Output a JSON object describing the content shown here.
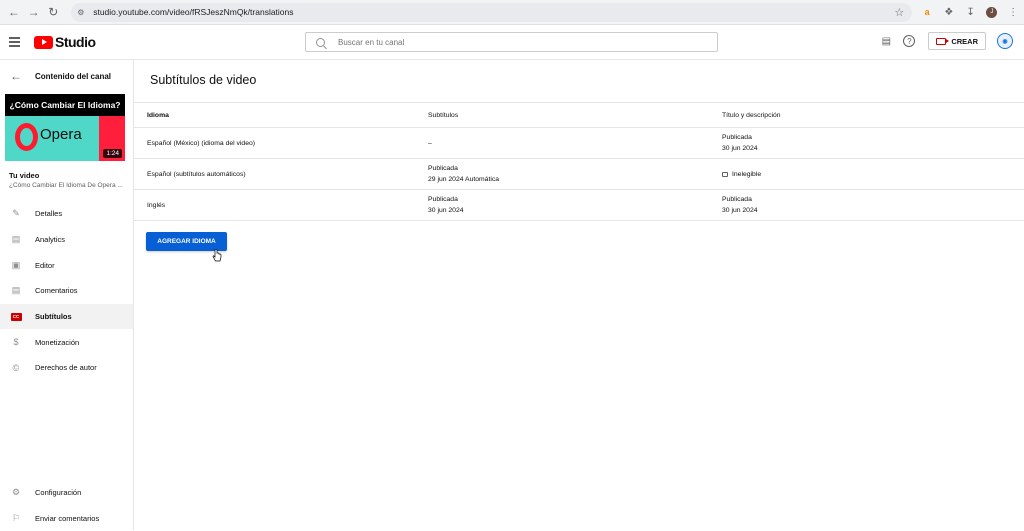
{
  "browser": {
    "url": "studio.youtube.com/video/fRSJeszNmQk/translations",
    "back_icon": "arrow-left",
    "forward_icon": "arrow-right",
    "reload_icon": "reload",
    "profile_initial": "J"
  },
  "header": {
    "logo_text": "Studio",
    "search_placeholder": "Buscar en tu canal",
    "create_label": "CREAR"
  },
  "sidebar": {
    "back_label": "Contenido del canal",
    "thumbnail": {
      "title": "¿Cómo Cambiar El Idioma?",
      "brand": "Opera",
      "duration": "1:24"
    },
    "your_video_label": "Tu video",
    "video_title": "¿Cómo Cambiar El Idioma De Opera ...",
    "items": [
      {
        "label": "Detalles",
        "icon": "pencil-icon"
      },
      {
        "label": "Analytics",
        "icon": "analytics-icon"
      },
      {
        "label": "Editor",
        "icon": "editor-icon"
      },
      {
        "label": "Comentarios",
        "icon": "comments-icon"
      },
      {
        "label": "Subtítulos",
        "icon": "subtitles-icon",
        "active": true
      },
      {
        "label": "Monetización",
        "icon": "dollar-icon"
      },
      {
        "label": "Derechos de autor",
        "icon": "copyright-icon"
      }
    ],
    "bottom_items": [
      {
        "label": "Configuración",
        "icon": "gear-icon"
      },
      {
        "label": "Enviar comentarios",
        "icon": "feedback-icon"
      }
    ]
  },
  "main": {
    "title": "Subtítulos de video",
    "columns": [
      "Idioma",
      "Subtítulos",
      "Título y descripción"
    ],
    "rows": [
      {
        "language": "Español (México) (idioma del video)",
        "subs_line1": "–",
        "subs_line2": "",
        "title_line1": "Publicada",
        "title_line2": "30 jun 2024"
      },
      {
        "language": "Español (subtítulos automáticos)",
        "subs_line1": "Publicada",
        "subs_line2": "29 jun 2024 Automática",
        "title_line1": "Inelegible",
        "title_line2": ""
      },
      {
        "language": "Inglés",
        "subs_line1": "Publicada",
        "subs_line2": "30 jun 2024",
        "title_line1": "Publicada",
        "title_line2": "30 jun 2024"
      }
    ],
    "add_button_label": "AGREGAR IDIOMA"
  }
}
